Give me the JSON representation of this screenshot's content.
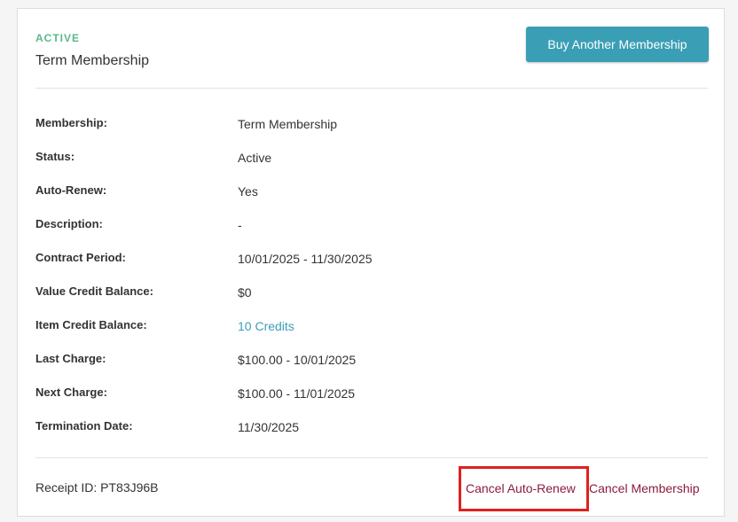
{
  "membership_card": {
    "status_label": "ACTIVE",
    "title": "Term Membership",
    "buy_button_label": "Buy Another Membership",
    "details": [
      {
        "key": "Membership:",
        "value": "Term Membership"
      },
      {
        "key": "Status:",
        "value": "Active"
      },
      {
        "key": "Auto-Renew:",
        "value": "Yes"
      },
      {
        "key": "Description:",
        "value": "-"
      },
      {
        "key": "Contract Period:",
        "value": "10/01/2025 - 11/30/2025"
      },
      {
        "key": "Value Credit Balance:",
        "value": "$0"
      },
      {
        "key": "Item Credit Balance:",
        "value": "10 Credits",
        "is_link": true
      },
      {
        "key": "Last Charge:",
        "value": "$100.00 - 10/01/2025"
      },
      {
        "key": "Next Charge:",
        "value": "$100.00 - 11/01/2025"
      },
      {
        "key": "Termination Date:",
        "value": "11/30/2025"
      }
    ],
    "receipt_text": "Receipt ID: PT83J96B",
    "cancel_auto_renew_label": "Cancel Auto-Renew",
    "cancel_membership_label": "Cancel Membership"
  },
  "colors": {
    "status_green": "#5cb88a",
    "button_teal": "#3a9fb5",
    "link_teal": "#3a9fb5",
    "cancel_link": "#8b1c3c",
    "highlight_red": "#e02020"
  }
}
